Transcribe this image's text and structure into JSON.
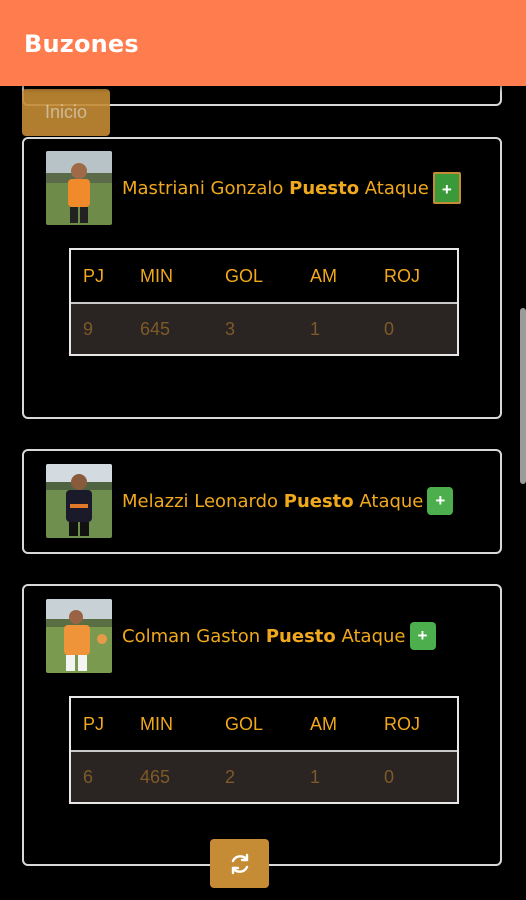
{
  "appbar": {
    "title": "Buzones"
  },
  "inicio_button": {
    "label": "Inicio"
  },
  "players": [
    {
      "name": "Mastriani Gonzalo",
      "puesto_label": "Puesto",
      "position": "Ataque",
      "add_label": "+",
      "stats": {
        "headers": [
          "PJ",
          "MIN",
          "GOL",
          "AM",
          "ROJ"
        ],
        "values": [
          "9",
          "645",
          "3",
          "1",
          "0"
        ]
      }
    },
    {
      "name": "Melazzi Leonardo",
      "puesto_label": "Puesto",
      "position": "Ataque",
      "add_label": "+"
    },
    {
      "name": "Colman Gaston",
      "puesto_label": "Puesto",
      "position": "Ataque",
      "add_label": "+",
      "stats": {
        "headers": [
          "PJ",
          "MIN",
          "GOL",
          "AM",
          "ROJ"
        ],
        "values": [
          "6",
          "465",
          "2",
          "1",
          "0"
        ]
      }
    }
  ],
  "refresh_button": {
    "icon": "refresh-icon"
  },
  "colors": {
    "appbar": "#fe7c4e",
    "accent": "#f0a81c",
    "button": "#c58b35",
    "add_button": "#4cae4c",
    "stats_row_bg": "#2a2422"
  }
}
